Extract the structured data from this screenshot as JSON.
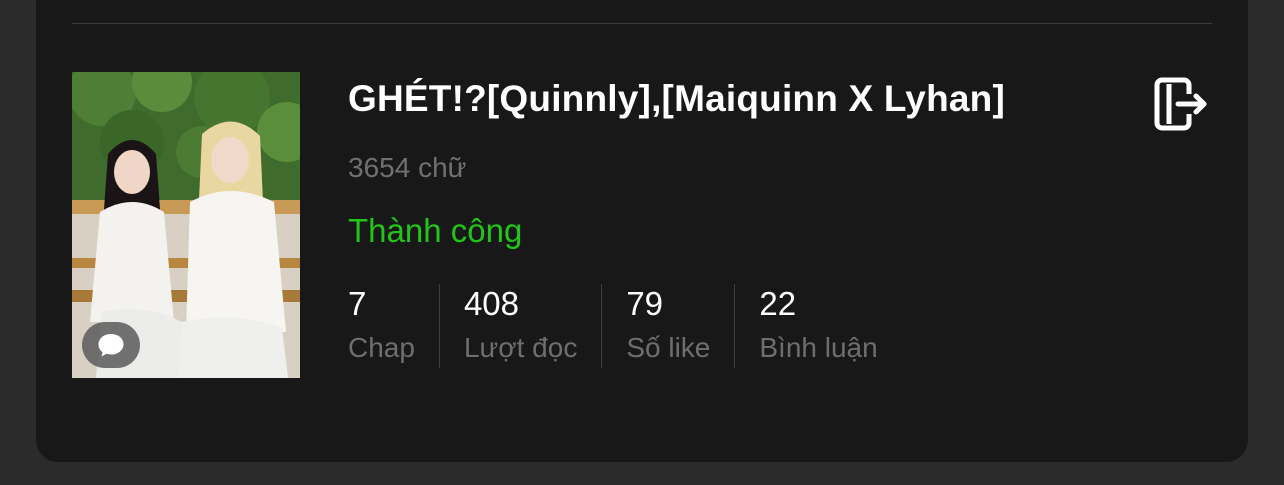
{
  "story": {
    "title": "GHÉT!?[Quinnly],[Maiquinn X Lyhan]",
    "word_count": "3654 chữ",
    "status": "Thành công",
    "status_color": "#22c41a",
    "cover_icon": "comment-icon",
    "action_icon": "exit-icon"
  },
  "stats": [
    {
      "value": "7",
      "label": "Chap"
    },
    {
      "value": "408",
      "label": "Lượt đọc"
    },
    {
      "value": "79",
      "label": "Số like"
    },
    {
      "value": "22",
      "label": "Bình luận"
    }
  ]
}
